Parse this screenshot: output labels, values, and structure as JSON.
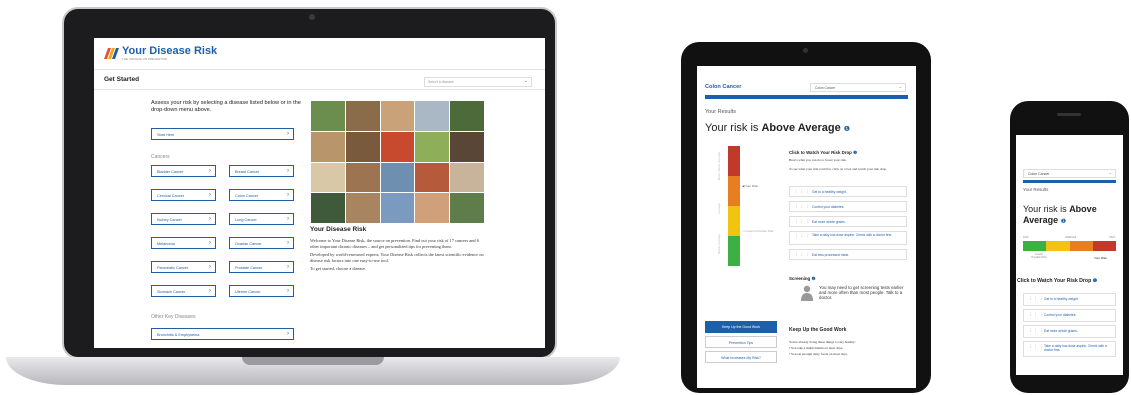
{
  "colors": {
    "brand_blue": "#1f5fa8",
    "very_high": "#c0392b",
    "high": "#e67e22",
    "average": "#f1c40f",
    "low": "#3cb043",
    "logo_red": "#e4572e",
    "logo_orange": "#f5a623"
  },
  "laptop": {
    "logo": {
      "name": "Your Disease Risk",
      "tagline": "THE SOURCE ON PREVENTION"
    },
    "header": {
      "title": "Get Started",
      "select_placeholder": "Select a disease"
    },
    "intro": "Assess your risk by selecting a disease listed below or in the drop-down menu above.",
    "start_here": "Start Here",
    "cancers_label": "Cancers",
    "cancers": [
      "Bladder Cancer",
      "Breast Cancer",
      "Cervical Cancer",
      "Colon Cancer",
      "Kidney Cancer",
      "Lung Cancer",
      "Melanoma",
      "Ovarian Cancer",
      "Pancreatic Cancer",
      "Prostate Cancer",
      "Stomach Cancer",
      "Uterine Cancer"
    ],
    "other_label": "Other Key Diseases",
    "other": [
      "Bronchitis & Emphysema"
    ],
    "about": {
      "title": "Your Disease Risk",
      "p1": "Welcome to Your Disease Risk, the source on prevention. Find out your risk of 17 cancers and 6 other important chronic diseases – and get personalized tips for preventing them.",
      "p2": "Developed by world-renowned experts, Your Disease Risk collects the latest scientific evidence on disease risk factors into one easy-to-use tool.",
      "p3": "To get started, choose a disease."
    }
  },
  "tablet": {
    "title": "Colon Cancer",
    "select_value": "Colon Cancer",
    "results_label": "Your Results",
    "risk_prefix": "Your risk is ",
    "risk_level": "Above Average",
    "gauge_your_risk": "Your Risk",
    "gauge_lowest": "Lowest Possible Risk",
    "gauge_side": [
      "Much Above Average",
      "Average",
      "Below Average"
    ],
    "watch_title": "Click to Watch Your Risk Drop",
    "watch_note1": "Here's what you can do to lower your risk.",
    "watch_note2": "To see what your risk could be, click on a box and watch your risk drop.",
    "tips": [
      "Get to a healthy weight.",
      "Control your diabetes.",
      "Eat more whole grains.",
      "Take a daily low-dose aspirin. Check with a doctor first.",
      "Eat less processed meat."
    ],
    "screening_title": "Screening",
    "screening_text": "You may need to get screening tests earlier and more often than most people. Talk to a doctor.",
    "nav": [
      "Keep Up the Good Work",
      "Prevention Tips",
      "What Increases My Risk?"
    ],
    "keep_title": "Keep Up the Good Work",
    "keep_intro": "You're already doing these things to stay healthy:",
    "keep_items": [
      "• You take a multivitamin on most days.",
      "• You eat enough dairy foods on most days."
    ]
  },
  "phone": {
    "select_value": "Colon Cancer",
    "results_label": "Your Results",
    "risk_prefix": "Your risk is ",
    "risk_level": "Above Average",
    "ticks": [
      "LOW",
      "AVERAGE",
      "HIGH"
    ],
    "lowest": "Lowest Possible Risk",
    "your_risk": "Your Risk",
    "watch_title": "Click to Watch Your Risk Drop",
    "tips": [
      "Get to a healthy weight.",
      "Control your diabetes.",
      "Eat more whole grains.",
      "Take a daily low-dose aspirin. Check with a doctor first."
    ]
  }
}
